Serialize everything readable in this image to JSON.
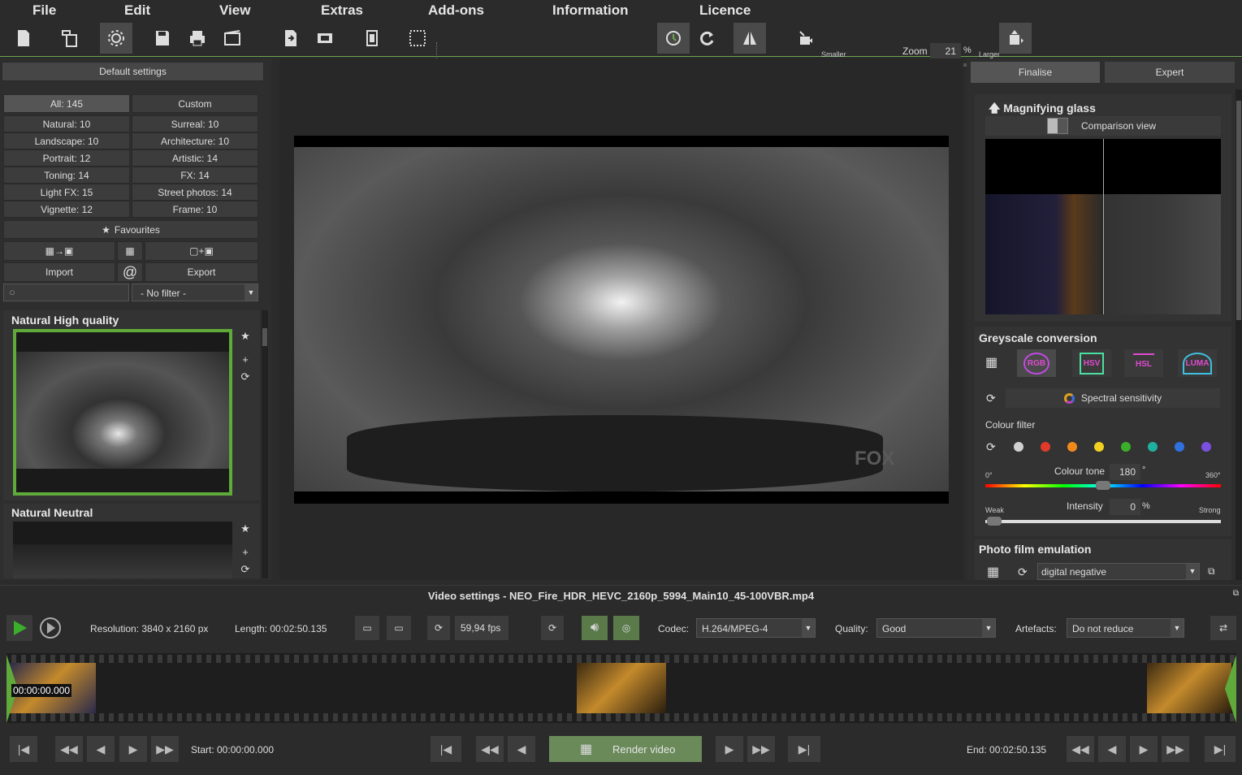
{
  "menu": [
    "File",
    "Edit",
    "View",
    "Extras",
    "Add-ons",
    "Information",
    "Licence"
  ],
  "toolbar": {
    "zoom_label": "Zoom",
    "zoom_value": "21",
    "zoom_unit": "%",
    "smaller_label": "Smaller",
    "larger_label": "Larger"
  },
  "left": {
    "default_settings": "Default settings",
    "cat_all": "All: 145",
    "cat_custom": "Custom",
    "categories": [
      [
        "Natural: 10",
        "Surreal: 10"
      ],
      [
        "Landscape: 10",
        "Architecture: 10"
      ],
      [
        "Portrait: 12",
        "Artistic: 14"
      ],
      [
        "Toning: 14",
        "FX: 14"
      ],
      [
        "Light FX: 15",
        "Street photos: 14"
      ],
      [
        "Vignette: 12",
        "Frame: 10"
      ]
    ],
    "favourites": "Favourites",
    "import": "Import",
    "export": "Export",
    "at": "@",
    "filter_value": "- No filter -",
    "presets": [
      "Natural High quality",
      "Natural Neutral"
    ]
  },
  "right": {
    "tab_finalise": "Finalise",
    "tab_expert": "Expert",
    "magnifying_glass": "Magnifying glass",
    "comparison_view": "Comparison view",
    "greyscale_conversion": "Greyscale conversion",
    "gs_modes": [
      "RGB",
      "HSV",
      "HSL",
      "LUMA"
    ],
    "spectral_sensitivity": "Spectral sensitivity",
    "colour_filter": "Colour filter",
    "filter_colors": [
      "#d0d0d0",
      "#e03a2a",
      "#f08a1a",
      "#f0d020",
      "#3ab02a",
      "#20b0a0",
      "#3070e0",
      "#7a50e0"
    ],
    "colour_tone_label": "Colour tone",
    "colour_tone_value": "180",
    "colour_tone_unit": "°",
    "tone_min": "0°",
    "tone_max": "360°",
    "colour_tone_fraction": 0.5,
    "intensity_label": "Intensity",
    "intensity_value": "0",
    "intensity_unit": "%",
    "weak": "Weak",
    "strong": "Strong",
    "intensity_fraction": 0.0,
    "photo_film_emulation": "Photo film emulation",
    "film_value": "digital negative"
  },
  "video": {
    "title": "Video settings - NEO_Fire_HDR_HEVC_2160p_5994_Main10_45-100VBR.mp4",
    "resolution": "Resolution: 3840 x 2160 px",
    "length": "Length: 00:02:50.135",
    "fps": "59,94 fps",
    "codec_label": "Codec:",
    "codec_value": "H.264/MPEG-4",
    "quality_label": "Quality:",
    "quality_value": "Good",
    "artefacts_label": "Artefacts:",
    "artefacts_value": "Do not reduce",
    "timecode": "00:00:00.000",
    "start": "Start: 00:00:00.000",
    "end": "End: 00:02:50.135",
    "render": "Render video"
  },
  "colors": {
    "accent_green": "#5faa3a",
    "panel": "#2e2e2e"
  }
}
